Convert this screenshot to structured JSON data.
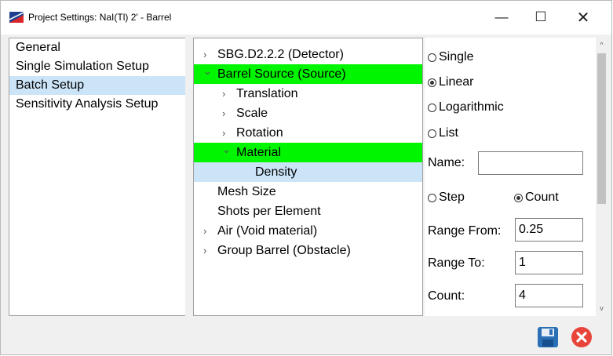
{
  "window": {
    "title": "Project Settings: NaI(Tl) 2' - Barrel",
    "minimize_glyph": "—",
    "maximize_glyph": "☐",
    "close_glyph": "✕"
  },
  "left_nav": {
    "items": [
      {
        "label": "General",
        "selected": false
      },
      {
        "label": "Single Simulation Setup",
        "selected": false
      },
      {
        "label": "Batch Setup",
        "selected": true
      },
      {
        "label": "Sensitivity Analysis Setup",
        "selected": false
      }
    ]
  },
  "tree": {
    "nodes": [
      {
        "label": "SBG.D2.2.2 (Detector)",
        "chevron": "›"
      },
      {
        "label": "Barrel Source (Source)",
        "chevron": "⌄"
      },
      {
        "label": "Translation",
        "chevron": "›"
      },
      {
        "label": "Scale",
        "chevron": "›"
      },
      {
        "label": "Rotation",
        "chevron": "›"
      },
      {
        "label": "Material",
        "chevron": "⌄"
      },
      {
        "label": "Density",
        "chevron": ""
      },
      {
        "label": "Mesh Size",
        "chevron": ""
      },
      {
        "label": "Shots per Element",
        "chevron": ""
      },
      {
        "label": "Air (Void material)",
        "chevron": "›"
      },
      {
        "label": "Group Barrel (Obstacle)",
        "chevron": "›"
      }
    ]
  },
  "options": {
    "mode_radios": [
      {
        "label": "Single",
        "checked": false
      },
      {
        "label": "Linear",
        "checked": true
      },
      {
        "label": "Logarithmic",
        "checked": false
      },
      {
        "label": "List",
        "checked": false
      }
    ],
    "name_label": "Name:",
    "name_value": "",
    "step_label": "Step",
    "step_checked": false,
    "count_radio_label": "Count",
    "count_radio_checked": true,
    "range_from_label": "Range From:",
    "range_from_value": "0.25",
    "range_to_label": "Range To:",
    "range_to_value": "1",
    "count_label": "Count:",
    "count_value": "4"
  },
  "scrollbar": {
    "up_glyph": "^",
    "down_glyph": "v"
  },
  "colors": {
    "highlight_green": "#00f500",
    "highlight_blue": "#cce4f7",
    "save_icon": "#2b6fb6",
    "cancel_icon": "#e8443a"
  }
}
